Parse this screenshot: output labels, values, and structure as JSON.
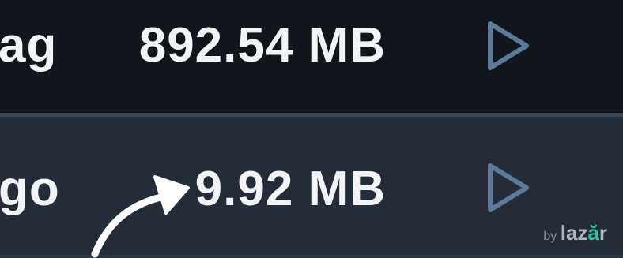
{
  "rows": [
    {
      "name": "ag",
      "size": "892.54 MB",
      "action_icon": "play-icon"
    },
    {
      "name": "go",
      "size": "9.92 MB",
      "action_icon": "play-icon"
    }
  ],
  "annotation": {
    "icon": "curved-arrow-icon"
  },
  "watermark": {
    "prefix": "by",
    "brand_start": "laz",
    "brand_accent": "ă",
    "brand_end": "r"
  },
  "colors": {
    "row_dark": "#11161c",
    "row_highlight": "#232c37",
    "divider": "#3a4855",
    "text": "#f1f3f5",
    "play_icon": "#5d7a98",
    "annotation_arrow": "#ffffff",
    "brand_accent": "#2cc4a0"
  }
}
